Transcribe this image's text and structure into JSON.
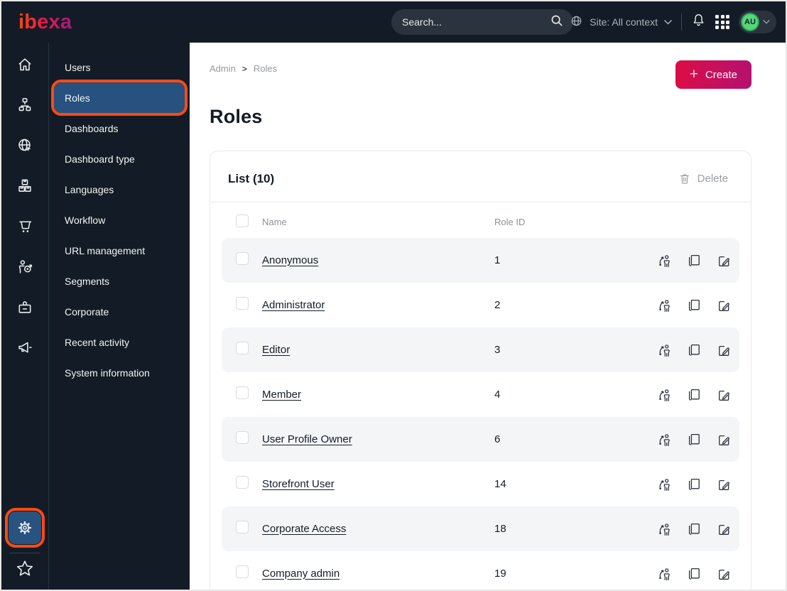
{
  "topbar": {
    "logo_text": "ibexa",
    "search": {
      "placeholder": "Search..."
    },
    "site_context": {
      "label": "Site: All context",
      "icon": "globe-icon"
    },
    "icons": [
      "bell-icon",
      "apps-grid-icon"
    ],
    "avatar": {
      "initials": "AU"
    }
  },
  "icon_sidebar": {
    "items": [
      {
        "name": "home",
        "icon": "home-icon"
      },
      {
        "name": "content-tree",
        "icon": "sitemap-icon"
      },
      {
        "name": "site",
        "icon": "globe-cursor-icon"
      },
      {
        "name": "products",
        "icon": "boxes-icon"
      },
      {
        "name": "commerce",
        "icon": "cart-icon"
      },
      {
        "name": "personalization",
        "icon": "person-target-icon"
      },
      {
        "name": "corporate",
        "icon": "badge-icon"
      },
      {
        "name": "campaigns",
        "icon": "megaphone-icon"
      }
    ],
    "bottom": [
      {
        "name": "settings",
        "icon": "gear-icon",
        "highlighted": true
      },
      {
        "name": "bookmarks",
        "icon": "star-icon",
        "highlighted": false
      }
    ]
  },
  "menu": {
    "items": [
      {
        "label": "Users",
        "active": false
      },
      {
        "label": "Roles",
        "active": true
      },
      {
        "label": "Dashboards",
        "active": false
      },
      {
        "label": "Dashboard type",
        "active": false
      },
      {
        "label": "Languages",
        "active": false
      },
      {
        "label": "Workflow",
        "active": false
      },
      {
        "label": "URL management",
        "active": false
      },
      {
        "label": "Segments",
        "active": false
      },
      {
        "label": "Corporate",
        "active": false
      },
      {
        "label": "Recent activity",
        "active": false
      },
      {
        "label": "System information",
        "active": false
      }
    ]
  },
  "breadcrumb": {
    "items": [
      "Admin",
      "Roles"
    ],
    "separator": ">"
  },
  "page": {
    "title": "Roles",
    "create_label": "Create"
  },
  "list": {
    "title": "List (10)",
    "delete_label": "Delete",
    "columns": {
      "name": "Name",
      "role_id": "Role ID"
    },
    "row_actions": [
      "assign-user",
      "copy",
      "edit"
    ],
    "rows": [
      {
        "name": "Anonymous",
        "role_id": "1"
      },
      {
        "name": "Administrator",
        "role_id": "2"
      },
      {
        "name": "Editor",
        "role_id": "3"
      },
      {
        "name": "Member",
        "role_id": "4"
      },
      {
        "name": "User Profile Owner",
        "role_id": "6"
      },
      {
        "name": "Storefront User",
        "role_id": "14"
      },
      {
        "name": "Corporate Access",
        "role_id": "18"
      },
      {
        "name": "Company admin",
        "role_id": "19"
      }
    ]
  },
  "annotations": {
    "highlight_color": "#f94b15",
    "highlighted_elements": [
      "sidebar-item-roles",
      "nav-settings"
    ]
  },
  "colors": {
    "topbar_bg": "#131c26",
    "active_item_bg": "#27517e",
    "brand_gradient_start": "#dc0d45",
    "brand_gradient_end": "#b41170",
    "zebra_row": "#f4f5f7",
    "avatar_green": "#57d67d"
  }
}
